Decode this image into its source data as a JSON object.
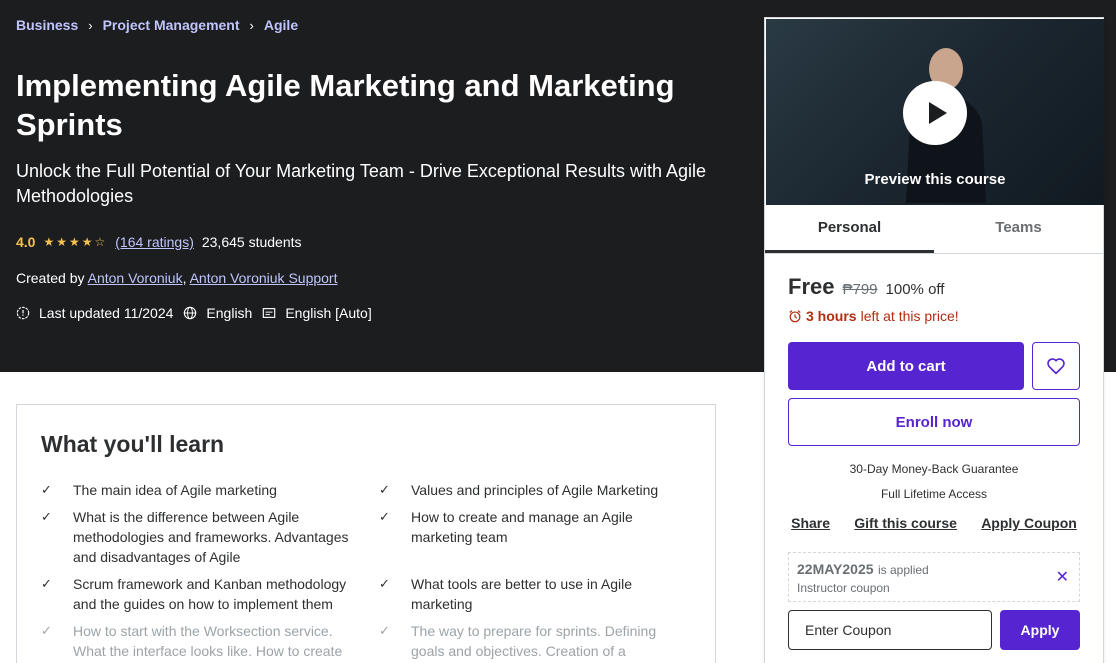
{
  "breadcrumb": [
    "Business",
    "Project Management",
    "Agile"
  ],
  "course": {
    "title": "Implementing Agile Marketing and Marketing Sprints",
    "subtitle": "Unlock the Full Potential of Your Marketing Team - Drive Exceptional Results with Agile Methodologies",
    "rating": "4.0",
    "stars_value": 4.0,
    "stars": "★★★★☆",
    "ratings_count": "(164 ratings)",
    "students": "23,645 students",
    "created_by_label": "Created by",
    "instructors": [
      "Anton Voroniuk",
      "Anton Voroniuk Support"
    ],
    "instructor_sep": ",",
    "last_updated": "Last updated 11/2024",
    "language": "English",
    "captions": "English [Auto]"
  },
  "learn": {
    "title": "What you'll learn",
    "items": [
      "The main idea of Agile marketing",
      "Values and principles of Agile Marketing",
      "What is the difference between Agile methodologies and frameworks. Advantages and disadvantages of Agile",
      "How to create and manage an Agile marketing team",
      "Scrum framework and Kanban methodology and the guides on how to implement them",
      "What tools are better to use in Agile marketing",
      "How to start with the Worksection service. What the interface looks like. How to create",
      "The way to prepare for sprints. Defining goals and objectives. Creation of a"
    ]
  },
  "sidebar": {
    "preview_label": "Preview this course",
    "tabs": [
      "Personal",
      "Teams"
    ],
    "price": "Free",
    "old_price": "₱799",
    "discount": "100% off",
    "timer_hours": "3 hours",
    "timer_rest": "left at this price!",
    "add_to_cart": "Add to cart",
    "enroll": "Enroll now",
    "guarantee": "30-Day Money-Back Guarantee",
    "lifetime": "Full Lifetime Access",
    "share": "Share",
    "gift": "Gift this course",
    "apply_coupon": "Apply Coupon",
    "coupon_code": "22MAY2025",
    "coupon_applied": "is applied",
    "coupon_type": "Instructor coupon",
    "coupon_placeholder": "Enter Coupon",
    "apply": "Apply"
  },
  "colors": {
    "hero_bg": "#1c1d1f",
    "accent": "#5624d0",
    "breadcrumb": "#c0c4fc",
    "star": "#f4c150",
    "timer": "#b32d0f"
  }
}
